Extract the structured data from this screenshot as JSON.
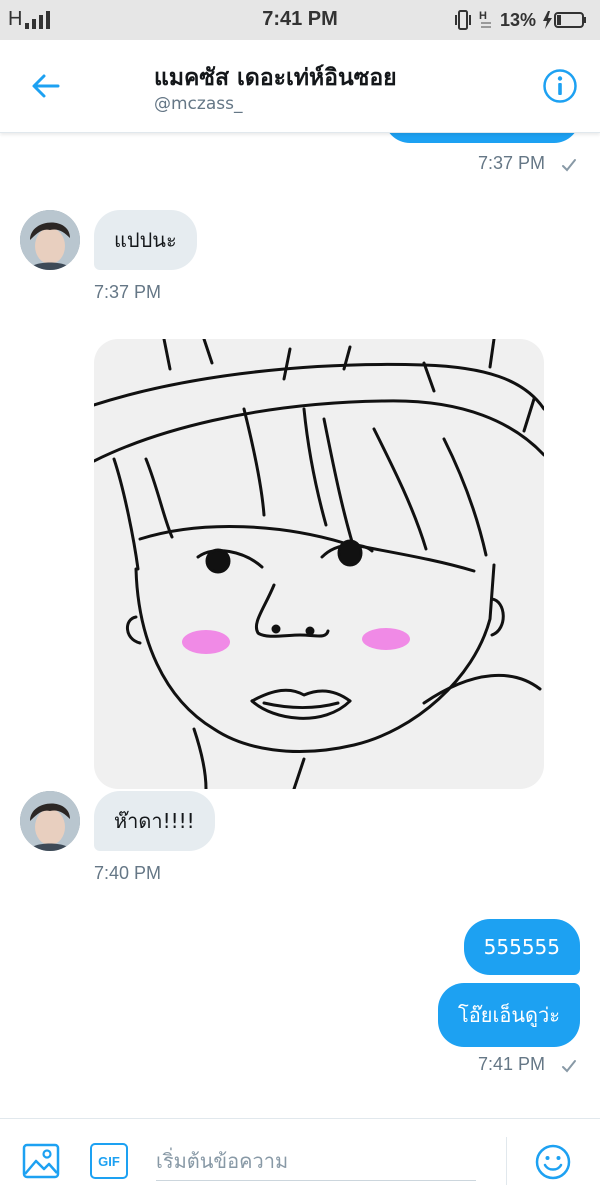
{
  "status_bar": {
    "carrier": "H",
    "time": "7:41 PM",
    "battery_percent": "13%",
    "icons": [
      "signal-icon",
      "vibrate-icon",
      "no-data-icon",
      "battery-charging-icon"
    ]
  },
  "header": {
    "name": "แมคซัส เดอะเท่ห์อินซอย",
    "handle": "@mczass_",
    "icons": [
      "back-arrow-icon",
      "info-icon"
    ]
  },
  "colors": {
    "accent": "#1da1f2",
    "incoming_bubble": "#e6ecf0",
    "timestamp": "#657786"
  },
  "messages": [
    {
      "direction": "out",
      "type": "text",
      "text": "",
      "time": "7:37 PM",
      "status": "sent-check"
    },
    {
      "direction": "in",
      "type": "text",
      "text": "แปปนะ",
      "time": "7:37 PM"
    },
    {
      "direction": "in",
      "type": "image",
      "description_icon": "sketch-drawing"
    },
    {
      "direction": "in",
      "type": "text",
      "text": "ห๊าดา!!!!",
      "time": "7:40 PM"
    },
    {
      "direction": "out",
      "type": "text",
      "text": "555555"
    },
    {
      "direction": "out",
      "type": "text",
      "text": "โอ๊ยเอ็นดูว่ะ",
      "time": "7:41 PM",
      "status": "sent-check"
    }
  ],
  "timestamps": {
    "first_out": "7:37 PM",
    "first_in": "7:37 PM",
    "second_in": "7:40 PM",
    "last_out": "7:41 PM"
  },
  "composer": {
    "placeholder": "เริ่มต้นข้อความ",
    "gif_label": "GIF",
    "icons": [
      "image-icon",
      "gif-icon",
      "emoji-icon"
    ]
  }
}
